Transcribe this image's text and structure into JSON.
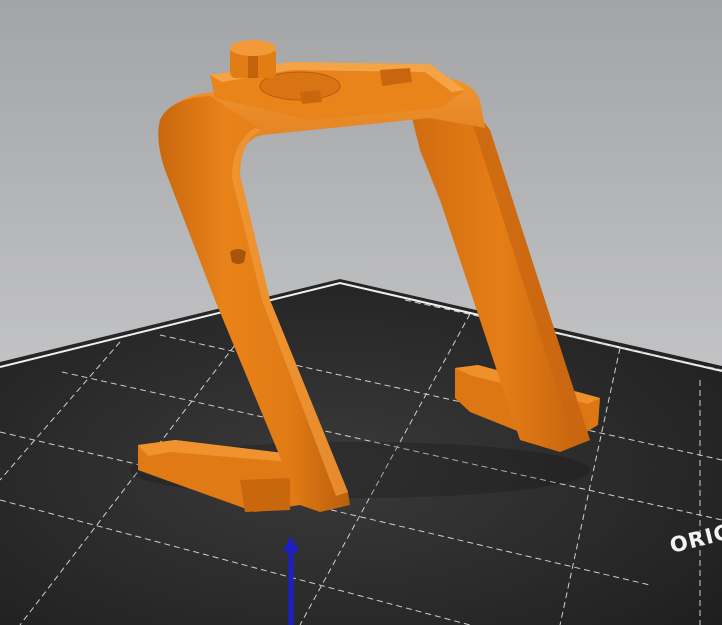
{
  "viewport": {
    "background_top": "#a7a8aa",
    "background_bottom": "#d4d5d7"
  },
  "bed": {
    "label": "ORIGINAL PRUSA",
    "surface_color": "#2b2b2b",
    "grid_color": "#d0d0d0",
    "edge_color": "#f2f2f2"
  },
  "model": {
    "color": "#e57e16",
    "shadow_color": "#a8540a",
    "highlight_color": "#f29a3a"
  },
  "axis": {
    "z_axis_color": "#1e1ec8",
    "icon": "z-axis-arrow-icon"
  }
}
